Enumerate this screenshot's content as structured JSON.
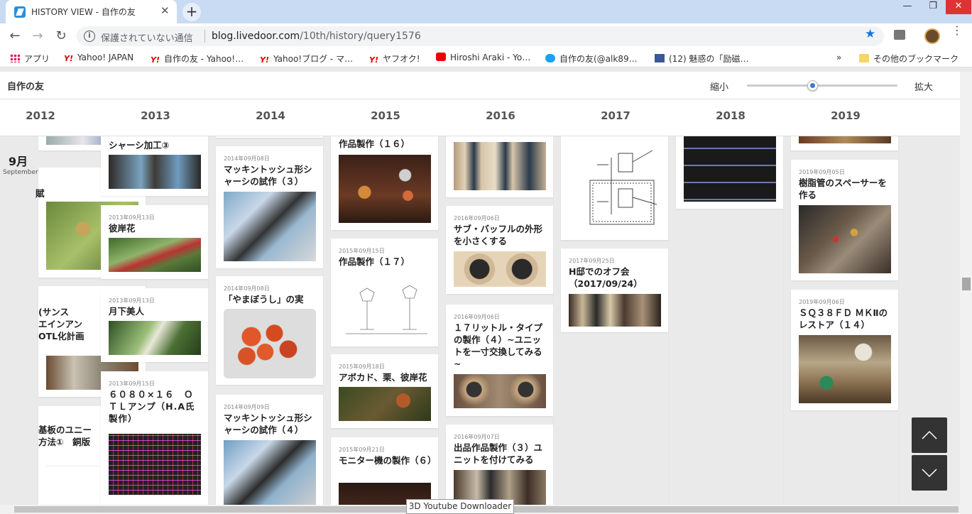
{
  "browser": {
    "tab_title": "HISTORY VIEW - 自作の友",
    "tab_close": "✕",
    "new_tab": "+",
    "security": "保護されていない通信",
    "url_domain": "blog.livedoor.com",
    "url_path": "/10th/history/query1576",
    "bookmarks": [
      "アプリ",
      "Yahoo! JAPAN",
      "自作の友 - Yahoo!…",
      "Yahoo!ブログ - マ…",
      "ヤフオク!",
      "Hiroshi Araki - Yo…",
      "自作の友(@alk89…",
      "(12) 魅惑の「励磁…",
      "»",
      "その他のブックマーク"
    ]
  },
  "page": {
    "site_title": "自作の友",
    "zoom_out": "縮小",
    "zoom_in": "拡大",
    "zoom_level": 0.43,
    "years": [
      "2012",
      "2013",
      "2014",
      "2015",
      "2016",
      "2017",
      "2018",
      "2019"
    ],
    "month": "9月",
    "month_en": "September",
    "tooltip": "3D Youtube Downloader",
    "columns": [
      {
        "cards": [
          {
            "date": "",
            "title": ""
          },
          {
            "date": "",
            "title": "賦"
          },
          {
            "date": "",
            "title": "(サンス\nエインアン\nOTL化計画"
          },
          {
            "date": "",
            "title": "基板のユニー\n方法①　銅版"
          }
        ]
      },
      {
        "cards": [
          {
            "date": "",
            "title": "シャーシ加工③"
          },
          {
            "date": "2013年09月13日",
            "title": "彼岸花"
          },
          {
            "date": "2013年09月13日",
            "title": "月下美人"
          },
          {
            "date": "2013年09月15日",
            "title": "６０８０×１６　ＯＴＬアンプ（H.A氏製作）"
          }
        ]
      },
      {
        "cards": [
          {
            "date": "",
            "title": ""
          },
          {
            "date": "2014年09月08日",
            "title": "マッキントッシュ形シャーシの試作（３）"
          },
          {
            "date": "2014年09月08日",
            "title": "「やまぼうし」の実"
          },
          {
            "date": "2014年09月09日",
            "title": "マッキントッシュ形シャーシの試作（４）"
          }
        ]
      },
      {
        "cards": [
          {
            "date": "",
            "title": "作品製作（１６）"
          },
          {
            "date": "2015年09月15日",
            "title": "作品製作（１７）"
          },
          {
            "date": "2015年09月18日",
            "title": "アボカド、栗、彼岸花"
          },
          {
            "date": "2015年09月21日",
            "title": "モニター機の製作（６）"
          }
        ]
      },
      {
        "cards": [
          {
            "date": "",
            "title": ""
          },
          {
            "date": "2016年09月06日",
            "title": "サブ・バッフルの外形を小さくする"
          },
          {
            "date": "2016年09月06日",
            "title": "１７リットル・タイプの製作（４）~ユニットを一寸交換してみる~"
          },
          {
            "date": "2016年09月07日",
            "title": "出品作品製作（３）ユニットを付けてみる"
          }
        ]
      },
      {
        "cards": [
          {
            "date": "",
            "title": ""
          },
          {
            "date": "2017年09月25日",
            "title": "H邸でのオフ会（2017/09/24）"
          }
        ]
      },
      {
        "cards": [
          {
            "date": "",
            "title": ""
          }
        ]
      },
      {
        "cards": [
          {
            "date": "",
            "title": ""
          },
          {
            "date": "2019年09月05日",
            "title": "樹脂管のスペーサーを作る"
          },
          {
            "date": "2019年09月06日",
            "title": "ＳＱ３８ＦＤ ＭＫⅡのレストア（１４）"
          }
        ]
      }
    ]
  },
  "icons": [
    "apps-icon",
    "yahoo-icon",
    "youtube-icon",
    "twitter-icon",
    "facebook-icon",
    "folder-icon",
    "info-icon",
    "star-icon",
    "extension-icon",
    "avatar",
    "menu-icon",
    "back-icon",
    "forward-icon",
    "reload-icon",
    "scroll-up-icon",
    "scroll-down-icon"
  ]
}
